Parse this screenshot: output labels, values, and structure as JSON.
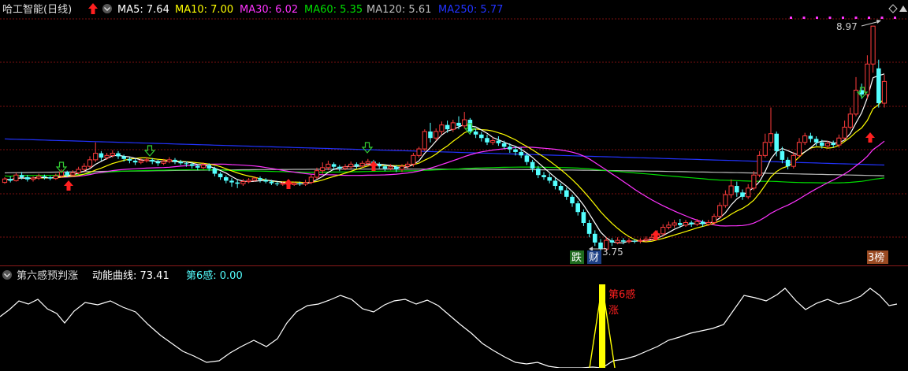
{
  "colors": {
    "bg": "#000000",
    "up": "#ff3c3c",
    "down": "#54ffff",
    "grid": "#7a1010",
    "ma5": "#ffffff",
    "ma10": "#ffff00",
    "ma30": "#ff33ff",
    "ma60": "#00dd00",
    "ma120": "#bbbbbb",
    "ma250": "#2233ff",
    "marker": "#ff33ff",
    "sub_line": "#ffffff",
    "signal": "#ffff00"
  },
  "main_header": {
    "title": "哈工智能(日线)",
    "ma5": "MA5: 7.64",
    "ma10": "MA10: 7.00",
    "ma30": "MA30: 6.02",
    "ma60": "MA60: 5.35",
    "ma120": "MA120: 5.61",
    "ma250": "MA250: 5.77"
  },
  "sub_header": {
    "name": "第六感预判涨",
    "line_label": "动能曲线: 73.41",
    "sense_label": "第6感: 0.00"
  },
  "annotations": {
    "high_label": "8.97",
    "low_label": "3.75",
    "badge_die": "跌",
    "badge_cai": "财",
    "badge_bang": "3榜",
    "sense_text1": "第6感",
    "sense_text2": "涨"
  },
  "chart_data": [
    {
      "type": "candlestick",
      "title": "哈工智能(日线)",
      "y_range": [
        3.6,
        9.1
      ],
      "high": 8.97,
      "low": 3.75,
      "series": [
        {
          "name": "MA5",
          "last": 7.64
        },
        {
          "name": "MA10",
          "last": 7.0
        },
        {
          "name": "MA30",
          "last": 6.02
        },
        {
          "name": "MA60",
          "last": 5.35
        },
        {
          "name": "MA120",
          "last": 5.61
        },
        {
          "name": "MA250",
          "last": 5.77
        }
      ],
      "candles": [
        [
          5.38,
          5.46,
          5.5,
          5.35
        ],
        [
          5.46,
          5.42,
          5.52,
          5.38
        ],
        [
          5.42,
          5.55,
          5.6,
          5.4
        ],
        [
          5.55,
          5.5,
          5.62,
          5.45
        ],
        [
          5.5,
          5.45,
          5.55,
          5.4
        ],
        [
          5.45,
          5.48,
          5.52,
          5.4
        ],
        [
          5.48,
          5.52,
          5.58,
          5.44
        ],
        [
          5.52,
          5.5,
          5.56,
          5.45
        ],
        [
          5.5,
          5.47,
          5.53,
          5.43
        ],
        [
          5.47,
          5.53,
          5.58,
          5.44
        ],
        [
          5.53,
          5.62,
          5.68,
          5.5
        ],
        [
          5.62,
          5.55,
          5.65,
          5.5
        ],
        [
          5.55,
          5.6,
          5.66,
          5.52
        ],
        [
          5.6,
          5.68,
          5.74,
          5.56
        ],
        [
          5.68,
          5.75,
          5.82,
          5.62
        ],
        [
          5.75,
          5.9,
          5.98,
          5.7
        ],
        [
          5.9,
          6.05,
          6.3,
          5.85
        ],
        [
          6.05,
          5.95,
          6.1,
          5.88
        ],
        [
          5.95,
          6.0,
          6.06,
          5.9
        ],
        [
          6.0,
          6.05,
          6.12,
          5.95
        ],
        [
          6.05,
          5.98,
          6.1,
          5.92
        ],
        [
          5.98,
          5.92,
          6.02,
          5.86
        ],
        [
          5.92,
          5.88,
          5.96,
          5.82
        ],
        [
          5.88,
          5.84,
          5.92,
          5.78
        ],
        [
          5.84,
          5.88,
          5.94,
          5.8
        ],
        [
          5.88,
          5.9,
          5.96,
          5.84
        ],
        [
          5.9,
          5.86,
          5.94,
          5.8
        ],
        [
          5.86,
          5.82,
          5.9,
          5.76
        ],
        [
          5.82,
          5.86,
          5.92,
          5.78
        ],
        [
          5.86,
          5.9,
          5.96,
          5.82
        ],
        [
          5.9,
          5.86,
          5.94,
          5.8
        ],
        [
          5.86,
          5.82,
          5.9,
          5.78
        ],
        [
          5.82,
          5.8,
          5.86,
          5.74
        ],
        [
          5.8,
          5.76,
          5.84,
          5.7
        ],
        [
          5.76,
          5.72,
          5.8,
          5.66
        ],
        [
          5.72,
          5.78,
          5.84,
          5.68
        ],
        [
          5.78,
          5.7,
          5.82,
          5.64
        ],
        [
          5.7,
          5.58,
          5.74,
          5.52
        ],
        [
          5.58,
          5.5,
          5.62,
          5.44
        ],
        [
          5.5,
          5.42,
          5.54,
          5.36
        ],
        [
          5.42,
          5.38,
          5.48,
          5.28
        ],
        [
          5.38,
          5.35,
          5.44,
          5.25
        ],
        [
          5.35,
          5.4,
          5.46,
          5.3
        ],
        [
          5.4,
          5.43,
          5.48,
          5.36
        ],
        [
          5.43,
          5.48,
          5.52,
          5.4
        ],
        [
          5.48,
          5.44,
          5.52,
          5.38
        ],
        [
          5.44,
          5.4,
          5.48,
          5.36
        ],
        [
          5.4,
          5.36,
          5.44,
          5.32
        ],
        [
          5.36,
          5.34,
          5.4,
          5.3
        ],
        [
          5.34,
          5.36,
          5.4,
          5.3
        ],
        [
          5.36,
          5.33,
          5.4,
          5.28
        ],
        [
          5.33,
          5.36,
          5.4,
          5.3
        ],
        [
          5.36,
          5.34,
          5.4,
          5.3
        ],
        [
          5.34,
          5.38,
          5.44,
          5.3
        ],
        [
          5.38,
          5.5,
          5.56,
          5.34
        ],
        [
          5.5,
          5.65,
          5.72,
          5.46
        ],
        [
          5.65,
          5.72,
          5.84,
          5.58
        ],
        [
          5.72,
          5.8,
          5.88,
          5.66
        ],
        [
          5.8,
          5.74,
          5.84,
          5.66
        ],
        [
          5.74,
          5.7,
          5.78,
          5.64
        ],
        [
          5.7,
          5.74,
          5.8,
          5.66
        ],
        [
          5.74,
          5.8,
          5.86,
          5.7
        ],
        [
          5.8,
          5.76,
          5.84,
          5.7
        ],
        [
          5.76,
          5.82,
          5.88,
          5.72
        ],
        [
          5.82,
          5.86,
          5.92,
          5.76
        ],
        [
          5.86,
          5.8,
          5.9,
          5.74
        ],
        [
          5.8,
          5.75,
          5.84,
          5.7
        ],
        [
          5.75,
          5.7,
          5.8,
          5.64
        ],
        [
          5.7,
          5.74,
          5.8,
          5.66
        ],
        [
          5.74,
          5.68,
          5.78,
          5.62
        ],
        [
          5.68,
          5.75,
          5.8,
          5.62
        ],
        [
          5.75,
          5.8,
          5.86,
          5.7
        ],
        [
          5.8,
          6.0,
          6.06,
          5.74
        ],
        [
          6.0,
          6.15,
          6.2,
          5.95
        ],
        [
          6.15,
          6.55,
          6.6,
          6.1
        ],
        [
          6.55,
          6.4,
          6.75,
          6.3
        ],
        [
          6.4,
          6.55,
          6.62,
          6.34
        ],
        [
          6.55,
          6.7,
          6.78,
          6.48
        ],
        [
          6.7,
          6.6,
          6.8,
          6.52
        ],
        [
          6.6,
          6.75,
          6.82,
          6.54
        ],
        [
          6.75,
          6.68,
          6.9,
          6.6
        ],
        [
          6.68,
          6.82,
          7.0,
          6.62
        ],
        [
          6.82,
          6.55,
          6.86,
          6.48
        ],
        [
          6.55,
          6.48,
          6.62,
          6.4
        ],
        [
          6.48,
          6.4,
          6.54,
          6.32
        ],
        [
          6.4,
          6.3,
          6.48,
          6.24
        ],
        [
          6.3,
          6.34,
          6.42,
          6.24
        ],
        [
          6.34,
          6.28,
          6.44,
          6.22
        ],
        [
          6.28,
          6.2,
          6.34,
          6.14
        ],
        [
          6.2,
          6.14,
          6.28,
          6.06
        ],
        [
          6.14,
          6.08,
          6.22,
          6.0
        ],
        [
          6.08,
          6.0,
          6.18,
          5.94
        ],
        [
          6.0,
          5.85,
          6.04,
          5.78
        ],
        [
          5.85,
          5.7,
          5.9,
          5.62
        ],
        [
          5.7,
          5.55,
          5.76,
          5.48
        ],
        [
          5.55,
          5.5,
          5.62,
          5.44
        ],
        [
          5.5,
          5.42,
          5.58,
          5.36
        ],
        [
          5.42,
          5.3,
          5.48,
          5.22
        ],
        [
          5.3,
          5.2,
          5.36,
          5.12
        ],
        [
          5.2,
          5.05,
          5.26,
          4.98
        ],
        [
          5.05,
          4.9,
          5.1,
          4.82
        ],
        [
          4.9,
          4.7,
          4.96,
          4.62
        ],
        [
          4.7,
          4.45,
          4.76,
          4.38
        ],
        [
          4.45,
          4.2,
          4.52,
          4.12
        ],
        [
          4.2,
          4.0,
          4.28,
          3.92
        ],
        [
          4.0,
          3.85,
          4.08,
          3.75
        ],
        [
          3.85,
          4.05,
          4.12,
          3.8
        ],
        [
          4.05,
          4.0,
          4.1,
          3.92
        ],
        [
          4.0,
          4.05,
          4.12,
          3.96
        ],
        [
          4.05,
          4.02,
          4.1,
          3.96
        ],
        [
          4.02,
          4.04,
          4.1,
          3.98
        ],
        [
          4.04,
          4.03,
          4.08,
          3.98
        ],
        [
          4.03,
          4.05,
          4.1,
          3.98
        ],
        [
          4.05,
          4.08,
          4.14,
          4.0
        ],
        [
          4.08,
          4.12,
          4.2,
          4.04
        ],
        [
          4.12,
          4.2,
          4.28,
          4.08
        ],
        [
          4.2,
          4.35,
          4.42,
          4.16
        ],
        [
          4.35,
          4.4,
          4.48,
          4.3
        ],
        [
          4.4,
          4.45,
          4.52,
          4.34
        ],
        [
          4.45,
          4.4,
          4.54,
          4.34
        ],
        [
          4.4,
          4.46,
          4.52,
          4.36
        ],
        [
          4.46,
          4.42,
          4.5,
          4.36
        ],
        [
          4.42,
          4.48,
          4.54,
          4.38
        ],
        [
          4.48,
          4.42,
          4.52,
          4.36
        ],
        [
          4.42,
          4.46,
          4.52,
          4.38
        ],
        [
          4.46,
          4.6,
          4.66,
          4.4
        ],
        [
          4.6,
          4.85,
          4.92,
          4.56
        ],
        [
          4.85,
          5.1,
          5.2,
          4.8
        ],
        [
          5.1,
          5.3,
          5.45,
          5.02
        ],
        [
          5.3,
          5.15,
          5.4,
          5.05
        ],
        [
          5.15,
          5.05,
          5.22,
          4.98
        ],
        [
          5.05,
          5.25,
          5.34,
          5.0
        ],
        [
          5.25,
          5.55,
          5.64,
          5.2
        ],
        [
          5.55,
          6.0,
          6.1,
          5.5
        ],
        [
          6.0,
          6.3,
          6.5,
          5.95
        ],
        [
          6.3,
          6.5,
          7.1,
          6.2
        ],
        [
          6.5,
          6.1,
          6.55,
          5.98
        ],
        [
          6.1,
          5.9,
          6.2,
          5.82
        ],
        [
          5.9,
          5.75,
          5.96,
          5.68
        ],
        [
          5.75,
          6.0,
          6.08,
          5.7
        ],
        [
          6.0,
          6.3,
          6.4,
          5.94
        ],
        [
          6.3,
          6.45,
          6.52,
          6.24
        ],
        [
          6.45,
          6.38,
          6.52,
          6.3
        ],
        [
          6.38,
          6.3,
          6.44,
          6.22
        ],
        [
          6.3,
          6.22,
          6.36,
          6.16
        ],
        [
          6.22,
          6.28,
          6.34,
          6.16
        ],
        [
          6.28,
          6.24,
          6.34,
          6.18
        ],
        [
          6.24,
          6.4,
          6.48,
          6.18
        ],
        [
          6.4,
          6.65,
          6.8,
          6.36
        ],
        [
          6.65,
          6.95,
          7.1,
          6.6
        ],
        [
          6.95,
          7.5,
          7.8,
          6.9
        ],
        [
          7.5,
          7.4,
          7.65,
          7.3
        ],
        [
          7.4,
          8.1,
          8.3,
          7.3
        ],
        [
          8.1,
          8.97,
          8.97,
          7.9
        ],
        [
          8.0,
          7.2,
          8.2,
          7.1
        ],
        [
          7.2,
          7.7,
          7.85,
          7.1
        ]
      ]
    },
    {
      "type": "line",
      "title": "第六感预判涨",
      "series": [
        {
          "name": "动能曲线",
          "last": 73.41
        },
        {
          "name": "第6感",
          "last": 0.0
        }
      ]
    }
  ]
}
